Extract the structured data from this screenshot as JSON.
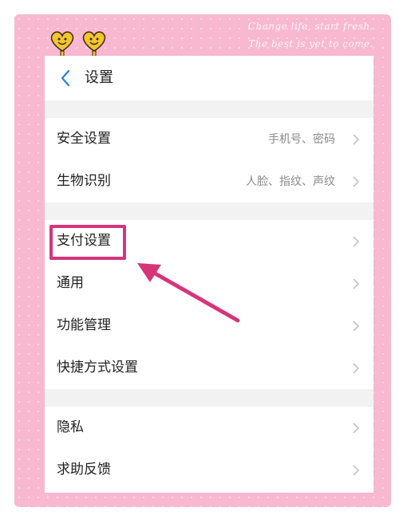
{
  "decoration": {
    "line1": "Change life, start fresh.",
    "line2": "The best is yet to come."
  },
  "nav": {
    "title": "设置"
  },
  "groups": [
    [
      {
        "label": "安全设置",
        "value": "手机号、密码"
      },
      {
        "label": "生物识别",
        "value": "人脸、指纹、声纹"
      }
    ],
    [
      {
        "label": "支付设置",
        "value": ""
      },
      {
        "label": "通用",
        "value": ""
      },
      {
        "label": "功能管理",
        "value": ""
      },
      {
        "label": "快捷方式设置",
        "value": ""
      }
    ],
    [
      {
        "label": "隐私",
        "value": ""
      },
      {
        "label": "求助反馈",
        "value": ""
      }
    ]
  ],
  "colors": {
    "frame": "#f7b8d0",
    "highlight": "#d6357a",
    "accent_back": "#2f7dd3"
  },
  "icons": {
    "back": "chevron-left-icon",
    "row_arrow": "chevron-right-icon",
    "decor": "smiling-hearts-icon"
  }
}
